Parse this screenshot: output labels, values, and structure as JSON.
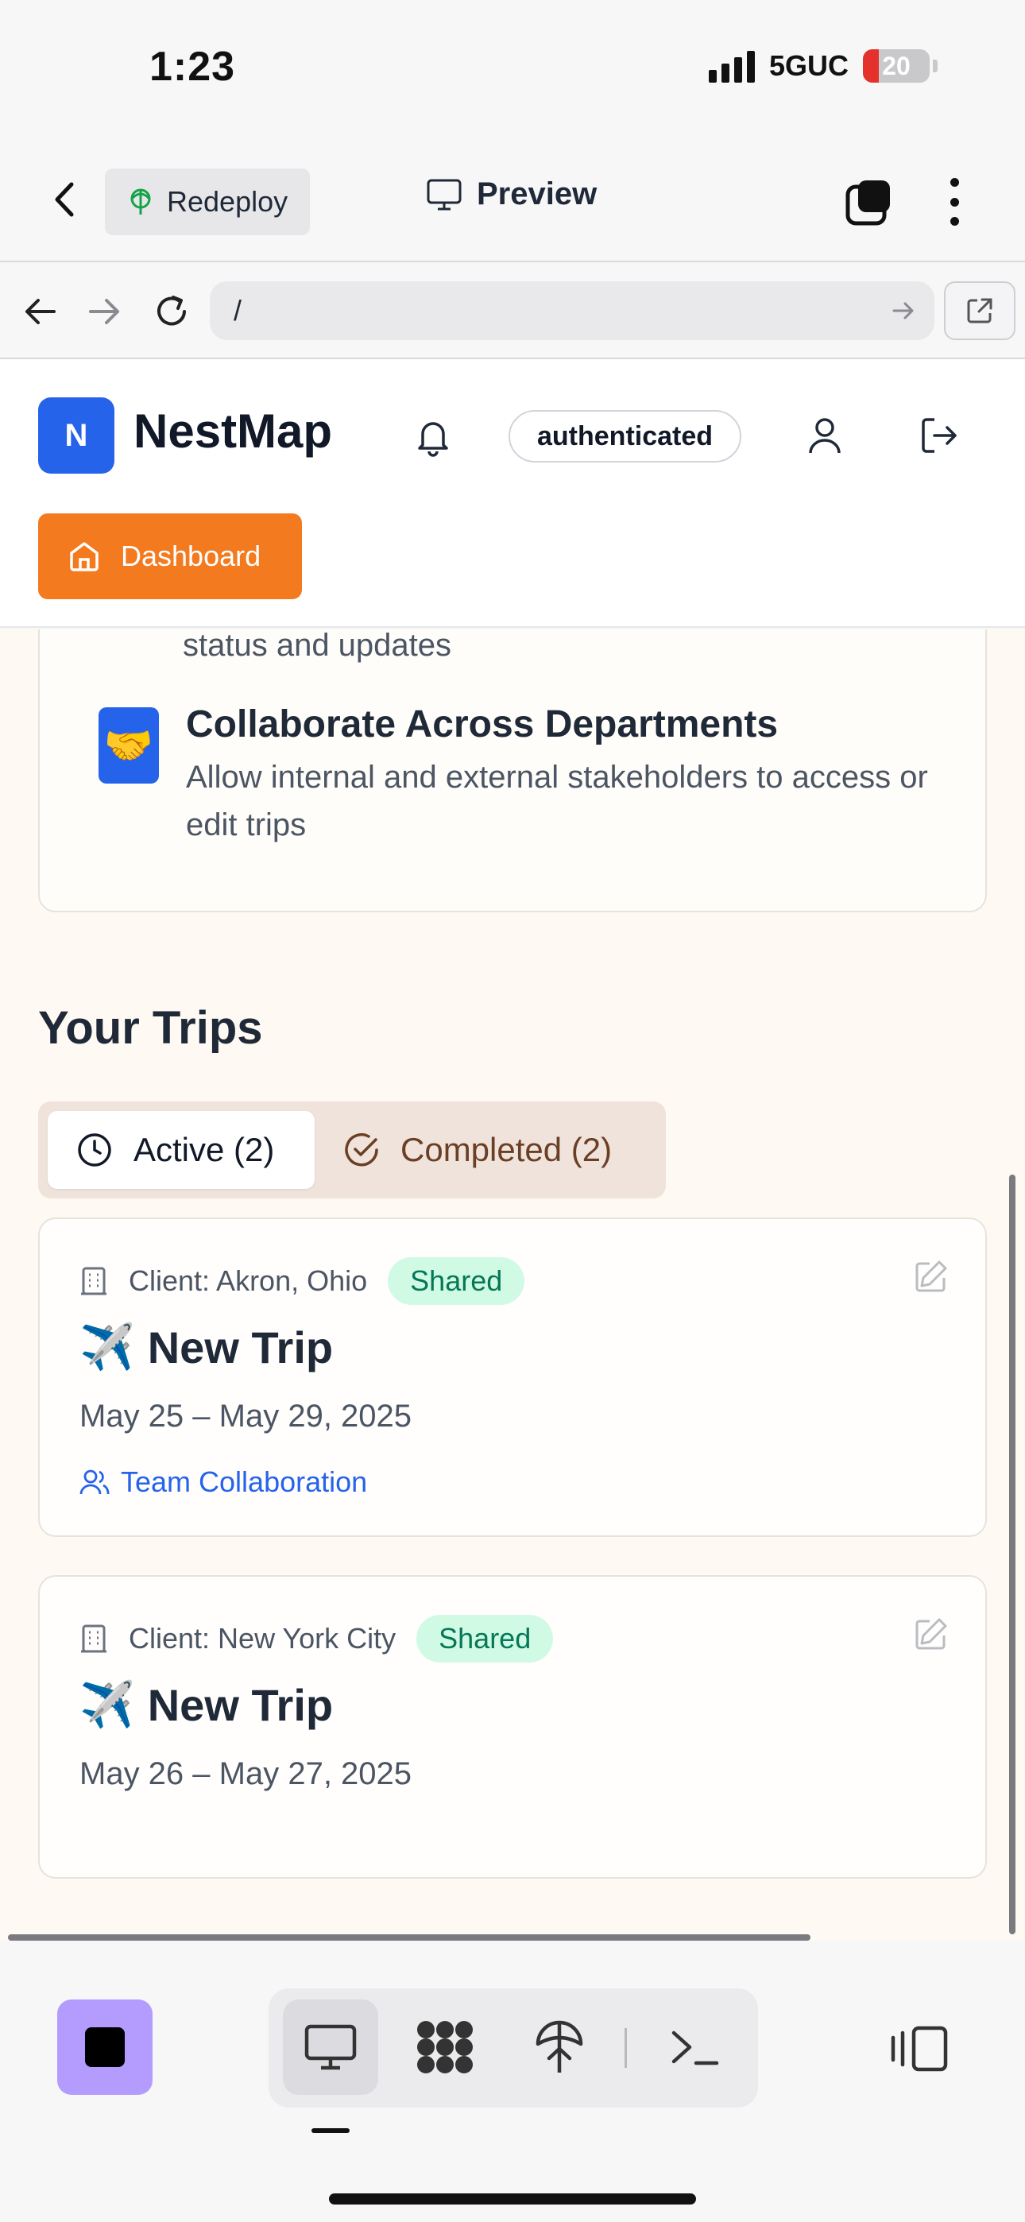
{
  "status_bar": {
    "time": "1:23",
    "network": "5GUC",
    "battery": "20"
  },
  "app_bar": {
    "redeploy_label": "Redeploy",
    "preview_label": "Preview"
  },
  "url_bar": {
    "url": "/"
  },
  "site_header": {
    "logo_letter": "N",
    "brand": "NestMap",
    "auth_status": "authenticated",
    "dashboard_label": "Dashboard"
  },
  "features": {
    "cut_text": "status and updates",
    "items": [
      {
        "icon": "🤝",
        "title": "Collaborate Across Departments",
        "description": "Allow internal and external stakeholders to access or edit trips"
      }
    ]
  },
  "trips": {
    "section_title": "Your Trips",
    "tabs": [
      {
        "label": "Active (2)",
        "icon": "clock-icon",
        "selected": true
      },
      {
        "label": "Completed (2)",
        "icon": "check-circle-icon",
        "selected": false
      }
    ],
    "items": [
      {
        "client": "Client: Akron, Ohio",
        "badge": "Shared",
        "emoji": "✈️",
        "title": "New Trip",
        "dates": "May 25 – May 29, 2025",
        "collab": "Team Collaboration"
      },
      {
        "client": "Client: New York City",
        "badge": "Shared",
        "emoji": "✈️",
        "title": "New Trip",
        "dates": "May 26 – May 27, 2025"
      }
    ]
  },
  "colors": {
    "accent_orange": "#f47a1f",
    "brand_blue": "#2563eb",
    "shared_badge_bg": "#d1fae5",
    "shared_badge_text": "#047857",
    "page_bg": "#fefaf3",
    "stop_purple": "#b49cff"
  }
}
